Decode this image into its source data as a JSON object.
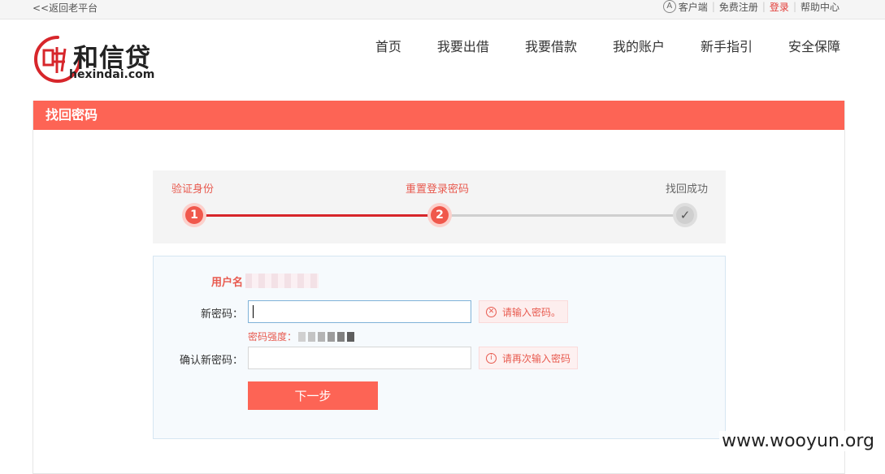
{
  "topbar": {
    "back": "<<返回老平台",
    "links": {
      "client": "客户端",
      "register": "免费注册",
      "login": "登录",
      "help": "帮助中心"
    }
  },
  "logo": {
    "name": "和信贷",
    "domain": "hexindai.com"
  },
  "nav": [
    "首页",
    "我要出借",
    "我要借款",
    "我的账户",
    "新手指引",
    "安全保障"
  ],
  "panel": {
    "title": "找回密码"
  },
  "steps": {
    "labels": [
      "验证身份",
      "重置登录密码",
      "找回成功"
    ],
    "numbers": [
      "1",
      "2"
    ],
    "check": "✓",
    "current": 2
  },
  "form": {
    "username_label": "用户名",
    "new_password_label": "新密码：",
    "new_password_hint": "请输入密码。",
    "strength_label": "密码强度：",
    "strength_colors": [
      "#d0d0d0",
      "#c4c4c4",
      "#b4b4b4",
      "#9c9c9c",
      "#808080",
      "#5e5e5e"
    ],
    "confirm_label": "确认新密码：",
    "confirm_hint": "请再次输入密码",
    "next_button": "下一步"
  },
  "colors": {
    "accent": "#fd6455",
    "active_track": "#d7262b"
  },
  "watermark": "www.wooyun.org"
}
